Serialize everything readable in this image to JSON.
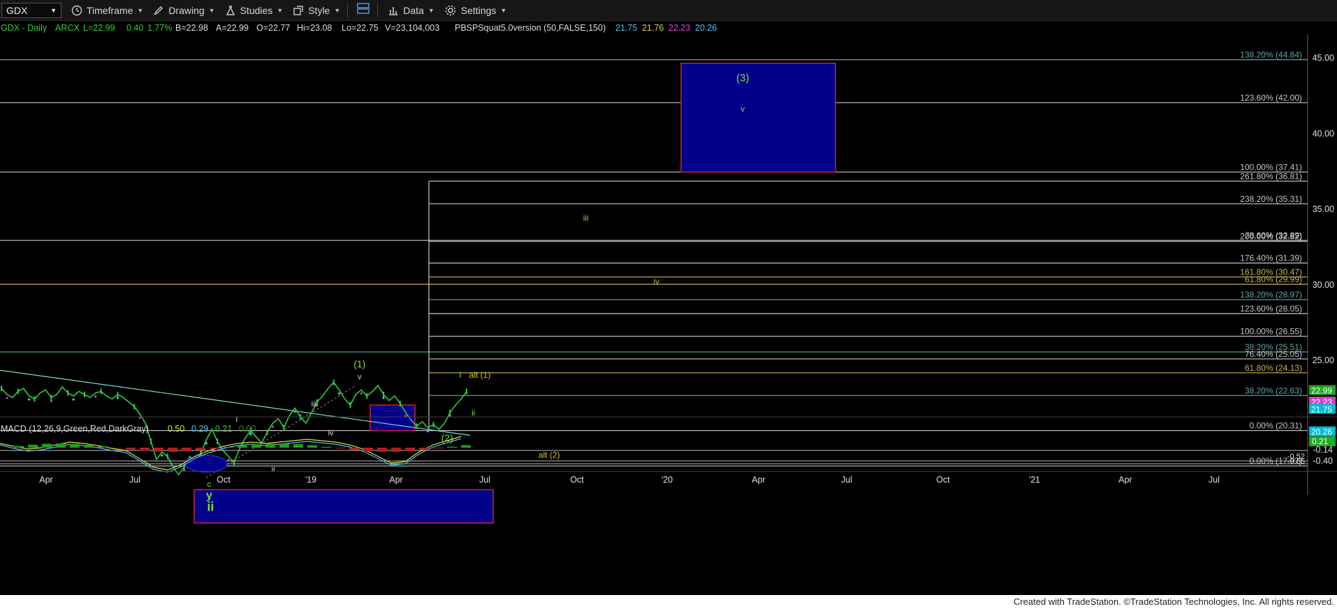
{
  "toolbar": {
    "symbol": "GDX",
    "menus": [
      "Timeframe",
      "Drawing",
      "Studies",
      "Style",
      "Data",
      "Settings"
    ]
  },
  "header": {
    "items": [
      {
        "text": "GDX - Daily",
        "color": "#32cd32"
      },
      {
        "text": "ARCX",
        "color": "#32cd32"
      },
      {
        "text": "L=22.99",
        "color": "#32cd32"
      },
      {
        "text": "0.40",
        "color": "#32cd32"
      },
      {
        "text": "1.77%",
        "color": "#32cd32"
      },
      {
        "text": "B=22.98",
        "color": "#dddddd"
      },
      {
        "text": "A=22.99",
        "color": "#dddddd"
      },
      {
        "text": "O=22.77",
        "color": "#dddddd"
      },
      {
        "text": "Hi=23.08",
        "color": "#dddddd"
      },
      {
        "text": "Lo=22.75",
        "color": "#dddddd"
      },
      {
        "text": "V=23,104,003",
        "color": "#dddddd"
      },
      {
        "text": "PBSPSquat5.0version (50,FALSE,150)",
        "color": "#dddddd"
      },
      {
        "text": "21.75",
        "color": "#4fc3f7"
      },
      {
        "text": "21.76",
        "color": "#e0d040"
      },
      {
        "text": "22.23",
        "color": "#e040e0"
      },
      {
        "text": "20.26",
        "color": "#4fc3f7"
      }
    ]
  },
  "chart_data": {
    "type": "line",
    "price_axis": {
      "min": 15.5,
      "max": 46.5,
      "ticks": [
        "45.00",
        "40.00",
        "35.00",
        "30.00",
        "25.00"
      ]
    },
    "price_markers": [
      {
        "value": 22.99,
        "label": "22.99",
        "bg": "#1faa1f",
        "fg": "#ffffff"
      },
      {
        "value": 22.23,
        "label": "22.23",
        "bg": "#cc44cc",
        "fg": "#ffffff"
      },
      {
        "value": 21.75,
        "label": "21.75",
        "bg": "#00bcd4",
        "fg": "#ffffff"
      },
      {
        "value": 20.26,
        "label": "20.26",
        "bg": "#00bcd4",
        "fg": "#ffffff"
      }
    ],
    "x_axis": {
      "ticks": [
        "Apr",
        "Jul",
        "Oct",
        "'19",
        "Apr",
        "Jul",
        "Oct",
        "'20",
        "Apr",
        "Jul",
        "Oct",
        "'21",
        "Apr",
        "Jul"
      ]
    },
    "price_series": {
      "name": "GDX",
      "color": "#2ecc40",
      "values": [
        23.1,
        22.7,
        22.5,
        22.9,
        23.1,
        22.6,
        22.4,
        22.8,
        23.0,
        22.5,
        22.7,
        23.2,
        22.8,
        22.6,
        22.9,
        22.7,
        22.5,
        22.8,
        22.9,
        22.6,
        22.4,
        22.7,
        22.5,
        22.2,
        21.9,
        21.4,
        20.8,
        19.6,
        18.4,
        18.9,
        18.6,
        17.9,
        17.4,
        17.9,
        18.6,
        18.3,
        18.8,
        19.7,
        20.4,
        19.6,
        19.0,
        18.6,
        18.2,
        19.1,
        19.8,
        20.3,
        19.9,
        19.5,
        20.2,
        20.8,
        21.1,
        20.5,
        21.3,
        21.8,
        21.2,
        20.8,
        21.5,
        22.2,
        22.6,
        23.1,
        23.5,
        23.0,
        22.4,
        22.0,
        22.7,
        23.0,
        22.6,
        22.9,
        23.3,
        22.7,
        22.3,
        22.6,
        22.1,
        21.5,
        21.0,
        20.6,
        20.9,
        20.5,
        20.7,
        20.4,
        20.8,
        21.5,
        22.0,
        22.4,
        22.9
      ]
    },
    "fib_lines": [
      {
        "label": "138.20% (44.84)",
        "value": 44.84,
        "color": "#5fa8a8",
        "from": "left"
      },
      {
        "label": "123.60% (42.00)",
        "value": 42.0,
        "color": "#c8c8c8",
        "from": "left"
      },
      {
        "label": "100.00% (37.41)",
        "value": 37.41,
        "color": "#c8c8c8",
        "from": "left"
      },
      {
        "label": "261.80% (36.81)",
        "value": 36.81,
        "color": "#c8c8c8",
        "from": "mid"
      },
      {
        "label": "238.20% (35.31)",
        "value": 35.31,
        "color": "#c8c8c8",
        "from": "mid"
      },
      {
        "label": "200.00% (32.82)",
        "value": 32.82,
        "color": "#c8c8c8",
        "from": "mid"
      },
      {
        "label": "78.60% (32.89)",
        "value": 32.89,
        "color": "#c8c8c8",
        "from": "left"
      },
      {
        "label": "176.40% (31.39)",
        "value": 31.39,
        "color": "#c8c8c8",
        "from": "mid"
      },
      {
        "label": "161.80% (30.47)",
        "value": 30.47,
        "color": "#c8b44a",
        "from": "mid"
      },
      {
        "label": "61.80% (29.99)",
        "value": 29.99,
        "color": "#c8b44a",
        "from": "left"
      },
      {
        "label": "138.20% (28.97)",
        "value": 28.97,
        "color": "#5fa8a8",
        "from": "mid"
      },
      {
        "label": "123.60% (28.05)",
        "value": 28.05,
        "color": "#c8c8c8",
        "from": "mid"
      },
      {
        "label": "100.00% (26.55)",
        "value": 26.55,
        "color": "#c8c8c8",
        "from": "mid"
      },
      {
        "label": "38.20% (25.51)",
        "value": 25.51,
        "color": "#5fa8a8",
        "from": "left"
      },
      {
        "label": "76.40% (25.05)",
        "value": 25.05,
        "color": "#c8c8c8",
        "from": "mid"
      },
      {
        "label": "61.80% (24.13)",
        "value": 24.13,
        "color": "#c8b44a",
        "from": "mid"
      },
      {
        "label": "38.20% (22.63)",
        "value": 22.63,
        "color": "#5fa8a8",
        "from": "mid"
      },
      {
        "label": "0.00% (20.31)",
        "value": 20.31,
        "color": "#c8c8c8",
        "from": "left"
      },
      {
        "label": "0.00% (17.97)",
        "value": 17.97,
        "color": "#c8c8c8",
        "from": "left"
      }
    ],
    "wave_labels": [
      {
        "text": "(3)",
        "color": "#7ddc3a",
        "size": 15,
        "xf": 0.568,
        "value": 43.4
      },
      {
        "text": "v",
        "color": "#7ddc3a",
        "size": 12,
        "xf": 0.568,
        "value": 41.4
      },
      {
        "text": "iii",
        "color": "#7ddc3a",
        "size": 12,
        "xf": 0.448,
        "value": 34.2
      },
      {
        "text": "iv",
        "color": "#7ddc3a",
        "size": 12,
        "xf": 0.502,
        "value": 30.0
      },
      {
        "text": "(1)",
        "color": "#7ddc3a",
        "size": 14,
        "xf": 0.275,
        "value": 24.5
      },
      {
        "text": "v",
        "color": "#dddddd",
        "size": 11,
        "xf": 0.275,
        "value": 23.7
      },
      {
        "text": "i",
        "color": "#7ddc3a",
        "size": 13,
        "xf": 0.352,
        "value": 23.8
      },
      {
        "text": "alt (1)",
        "color": "#e0c020",
        "size": 12,
        "xf": 0.367,
        "value": 23.8
      },
      {
        "text": "ii",
        "color": "#7ddc3a",
        "size": 12,
        "xf": 0.362,
        "value": 21.3
      },
      {
        "text": "(2)",
        "color": "#7ddc3a",
        "size": 14,
        "xf": 0.342,
        "value": 19.6
      },
      {
        "text": "alt (2)",
        "color": "#e0c020",
        "size": 12,
        "xf": 0.42,
        "value": 18.5
      },
      {
        "text": "iii",
        "color": "#dddddd",
        "size": 11,
        "xf": 0.24,
        "value": 21.9
      },
      {
        "text": "iv",
        "color": "#dddddd",
        "size": 11,
        "xf": 0.253,
        "value": 20.0
      },
      {
        "text": "i",
        "color": "#dddddd",
        "size": 11,
        "xf": 0.181,
        "value": 20.9
      },
      {
        "text": "ii",
        "color": "#dddddd",
        "size": 11,
        "xf": 0.209,
        "value": 17.6
      },
      {
        "text": "c",
        "color": "#7ddc3a",
        "size": 12,
        "xf": 0.16,
        "value": 16.6
      },
      {
        "text": "y",
        "color": "#7ddc3a",
        "size": 16,
        "xf": 0.16,
        "value": 15.8
      },
      {
        "text": "ii",
        "color": "#7ddc3a",
        "size": 18,
        "xf": 0.161,
        "value": 15.0
      }
    ],
    "macd": {
      "title": "MACD (12,26,9,Green,Red,DarkGray)",
      "values": [
        {
          "text": "0.50",
          "color": "#e0e040"
        },
        {
          "text": "0.29",
          "color": "#4fc3f7"
        },
        {
          "text": "0.21",
          "color": "#32cd32"
        },
        {
          "text": "0.00",
          "color": "#2e8b2e"
        }
      ],
      "axis_labels": [
        "-0.14",
        "-0.40"
      ],
      "axis_labels_small": [
        "-0.52",
        "-0.65"
      ],
      "current_tag": "0.21"
    }
  },
  "footer": {
    "text": "Created with TradeStation. ©TradeStation Technologies, Inc. All rights reserved."
  }
}
